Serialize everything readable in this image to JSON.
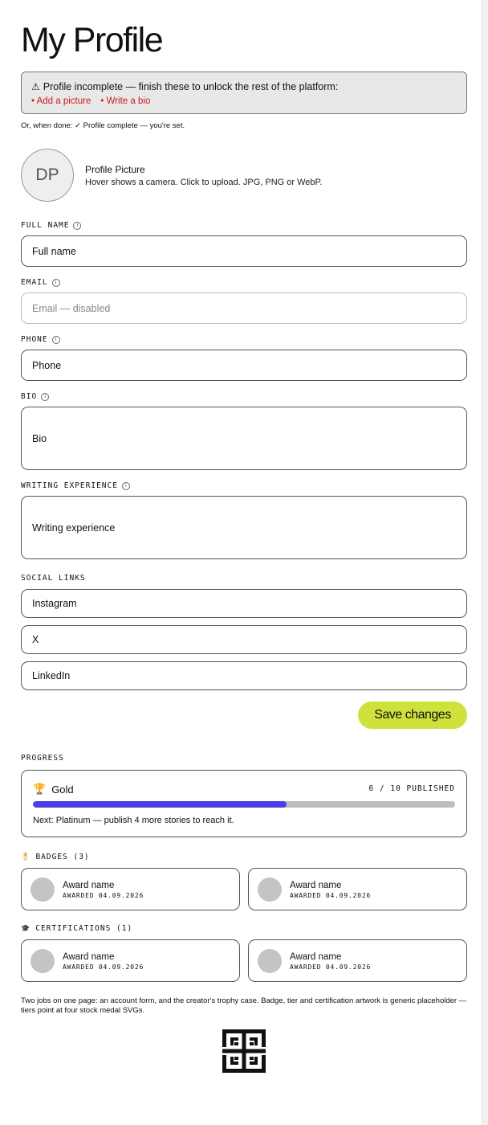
{
  "page": {
    "title": "My Profile"
  },
  "alert": {
    "warning_icon": "warning-icon",
    "message": "Profile incomplete — finish these to unlock the rest of the platform:",
    "todos": [
      "• Add a picture",
      "• Write a bio"
    ]
  },
  "done_note": "Or, when done: ✓ Profile complete — you're set.",
  "profile_picture": {
    "initials": "DP",
    "title": "Profile Picture",
    "description": "Hover shows a camera. Click to upload. JPG, PNG or WebP."
  },
  "form": {
    "full_name": {
      "label": "FULL NAME",
      "placeholder": "Full name"
    },
    "email": {
      "label": "EMAIL",
      "placeholder": "Email — disabled"
    },
    "phone": {
      "label": "PHONE",
      "placeholder": "Phone"
    },
    "bio": {
      "label": "BIO",
      "placeholder": "Bio"
    },
    "writing_experience": {
      "label": "WRITING EXPERIENCE",
      "placeholder": "Writing experience"
    },
    "social_links": {
      "label": "SOCIAL LINKS",
      "instagram": "Instagram",
      "x": "X",
      "linkedin": "LinkedIn"
    },
    "save_label": "Save changes"
  },
  "progress": {
    "label": "PROGRESS",
    "tier": "Gold",
    "tier_icon": "trophy-icon",
    "published_text": "6 / 10 PUBLISHED",
    "published": 6,
    "goal": 10,
    "next_text": "Next: Platinum — publish 4 more stories to reach it."
  },
  "badges": {
    "label": "BADGES (3)",
    "icon": "medal-icon",
    "items": [
      {
        "name": "Award name",
        "date": "AWARDED 04.09.2026"
      },
      {
        "name": "Award name",
        "date": "AWARDED 04.09.2026"
      }
    ]
  },
  "certifications": {
    "label": "CERTIFICATIONS (1)",
    "icon": "graduation-cap-icon",
    "items": [
      {
        "name": "Award name",
        "date": "AWARDED 04.09.2026"
      },
      {
        "name": "Award name",
        "date": "AWARDED 04.09.2026"
      }
    ]
  },
  "footnote": "Two jobs on one page: an account form, and the creator's trophy case. Badge, tier and certification artwork is generic placeholder — tiers point at four stock medal SVGs.",
  "colors": {
    "accent": "#cfe23b",
    "progress_fill": "#4b3ee6",
    "todo_red": "#c81e1e",
    "alert_bg": "#e8e8e8"
  }
}
